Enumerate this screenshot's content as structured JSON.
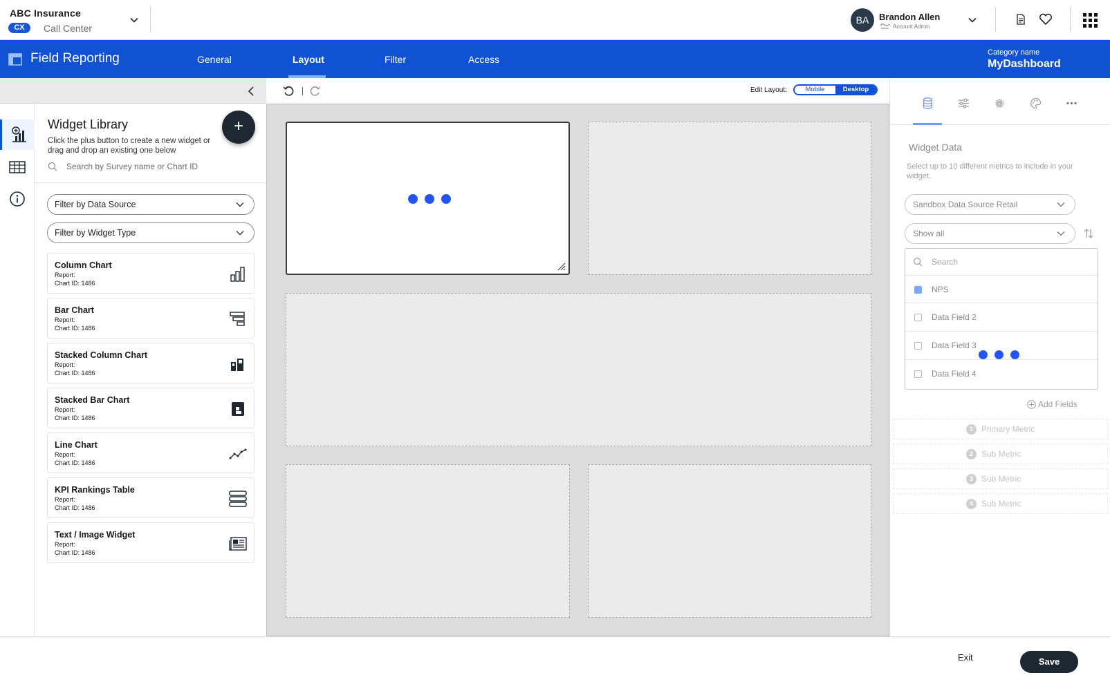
{
  "org": {
    "name": "ABC Insurance",
    "badge": "CX",
    "subtitle": "Call Center"
  },
  "user": {
    "initials": "BA",
    "name": "Brandon Allen",
    "role": "Account Admin"
  },
  "header": {
    "title": "Field Reporting",
    "tabs": [
      {
        "label": "General",
        "active": false
      },
      {
        "label": "Layout",
        "active": true
      },
      {
        "label": "Filter",
        "active": false
      },
      {
        "label": "Access",
        "active": false
      }
    ],
    "category_label": "Category name",
    "category_value": "MyDashboard"
  },
  "toolbar": {
    "edit_layout_label": "Edit Layout:",
    "toggle": {
      "mobile": "Mobile",
      "desktop": "Desktop",
      "selected": "Desktop"
    }
  },
  "library": {
    "title": "Widget Library",
    "description": "Click the plus button to create a new widget or drag and drop an existing one below",
    "plus_label": "+",
    "search_placeholder": "Search by Survey name or Chart ID",
    "filter_source": "Filter by Data Source",
    "filter_type": "Filter by Widget Type",
    "items": [
      {
        "title": "Column Chart",
        "report": "Report:",
        "chart_id": "Chart ID: 1486",
        "icon": "column-chart-icon"
      },
      {
        "title": "Bar Chart",
        "report": "Report:",
        "chart_id": "Chart ID: 1486",
        "icon": "bar-chart-icon"
      },
      {
        "title": "Stacked Column Chart",
        "report": "Report:",
        "chart_id": "Chart ID: 1486",
        "icon": "stacked-column-icon"
      },
      {
        "title": "Stacked Bar Chart",
        "report": "Report:",
        "chart_id": "Chart ID: 1486",
        "icon": "stacked-bar-icon"
      },
      {
        "title": "Line Chart",
        "report": "Report:",
        "chart_id": "Chart ID: 1486",
        "icon": "line-chart-icon"
      },
      {
        "title": "KPI Rankings Table",
        "report": "Report:",
        "chart_id": "Chart ID: 1486",
        "icon": "kpi-table-icon"
      },
      {
        "title": "Text / Image Widget",
        "report": "Report:",
        "chart_id": "Chart ID: 1486",
        "icon": "text-image-icon"
      }
    ]
  },
  "panel": {
    "title": "Widget Data",
    "description": "Select up to 10 different metrics to include in your widget.",
    "data_source": "Sandbox Data Source Retail",
    "show": "Show all",
    "search_placeholder": "Search",
    "fields": [
      {
        "label": "NPS",
        "checked": true
      },
      {
        "label": "Data Field 2",
        "checked": false
      },
      {
        "label": "Data Field 3",
        "checked": false
      },
      {
        "label": "Data Field 4",
        "checked": false
      }
    ],
    "add_fields": "Add Fields",
    "metrics": [
      {
        "num": "1",
        "label": "Primary Metric"
      },
      {
        "num": "2",
        "label": "Sub Metric"
      },
      {
        "num": "3",
        "label": "Sub Metric"
      },
      {
        "num": "4",
        "label": "Sub Metric"
      }
    ]
  },
  "footer": {
    "exit": "Exit",
    "save": "Save"
  },
  "colors": {
    "brand_blue": "#1152d4",
    "dark": "#1e2833",
    "loader_dot": "#2555f0"
  }
}
